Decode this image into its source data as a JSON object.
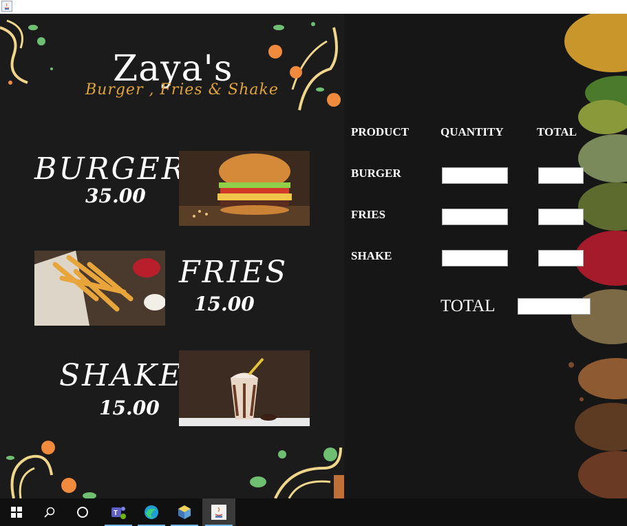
{
  "window": {
    "icon": "java-icon"
  },
  "menu": {
    "brand_name": "Zaya's",
    "brand_tagline": "Burger , Fries & Shake",
    "items": [
      {
        "name": "BURGER",
        "price": "35.00"
      },
      {
        "name": "FRIES",
        "price": "15.00"
      },
      {
        "name": "SHAKE",
        "price": "15.00"
      }
    ]
  },
  "order": {
    "headers": {
      "product": "PRODUCT",
      "quantity": "QUANTITY",
      "total": "TOTAL"
    },
    "rows": [
      {
        "product": "BURGER",
        "quantity": "",
        "total": ""
      },
      {
        "product": "FRIES",
        "quantity": "",
        "total": ""
      },
      {
        "product": "SHAKE",
        "quantity": "",
        "total": ""
      }
    ],
    "grand_total_label": "TOTAL",
    "grand_total_value": ""
  },
  "taskbar": {
    "items": [
      "windows-start-icon",
      "search-icon",
      "cortana-icon",
      "teams-icon",
      "edge-icon",
      "netbeans-icon",
      "java-icon"
    ],
    "active": "java-icon"
  },
  "colors": {
    "panel_bg": "#1b1b1b",
    "accent_gold": "#e0a23a",
    "accent_orange": "#f08a3c",
    "leaf_green": "#6fbf73",
    "taskbar_bg": "#101010"
  }
}
